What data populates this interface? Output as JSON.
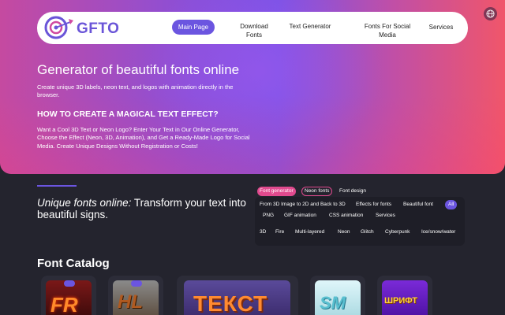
{
  "header": {
    "logo_text": "GFTO",
    "nav": [
      {
        "label": "Main Page",
        "active": true
      },
      {
        "label": "Download Fonts"
      },
      {
        "label": "Text Generator"
      },
      {
        "label": "Fonts For Social Media"
      },
      {
        "label": "Services"
      }
    ]
  },
  "hero": {
    "title": "Generator of beautiful fonts online",
    "subtitle": "Create unique 3D labels, neon text, and logos with animation directly in the browser.",
    "howto_title": "HOW TO CREATE A MAGICAL TEXT EFFECT?",
    "howto_text": "Want a Cool 3D Text or Neon Logo? Enter Your Text in Our Online Generator, Choose the Effect (Neon, 3D, Animation), and Get a Ready-Made Logo for Social Media. Create Unique Designs Without Registration or Costs!"
  },
  "unique": {
    "italic": "Unique fonts online:",
    "rest": " Transform your text into beautiful signs."
  },
  "tags": {
    "row1": [
      "Font generator",
      "Neon fonts",
      "Font design"
    ],
    "row2": [
      "From 3D Image to 2D and Back to 3D",
      "Effects for fonts",
      "Beautiful font",
      "All"
    ],
    "row3": [
      "PNG",
      "GIF animation",
      "CSS animation",
      "Services"
    ],
    "row4": [
      "3D",
      "Fire",
      "Multi-layered",
      "Neon",
      "Glitch",
      "Cyberpunk",
      "Ice/snow/water"
    ]
  },
  "catalog": {
    "title": "Font Catalog",
    "cards": [
      {
        "thumb_text": "FR"
      },
      {
        "thumb_text": "HL"
      },
      {
        "thumb_text": "ТЕКСТ"
      },
      {
        "thumb_text": "SM"
      },
      {
        "thumb_text": "ШРИФТ"
      }
    ]
  },
  "colors": {
    "accent": "#6b55e0",
    "pink": "#e04a8e",
    "background": "#24242e"
  }
}
